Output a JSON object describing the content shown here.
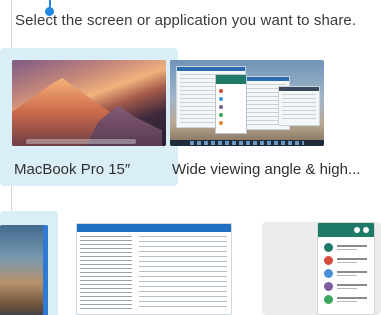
{
  "instruction": "Select the screen or application you want to share.",
  "screens": [
    {
      "label": "MacBook Pro 15″",
      "selected": true
    },
    {
      "label": "Wide viewing angle & high..."
    }
  ],
  "colors": {
    "accent": "#1e88e5",
    "selected_bg": "#d9eef7",
    "gray_card_bg": "#ececec"
  }
}
